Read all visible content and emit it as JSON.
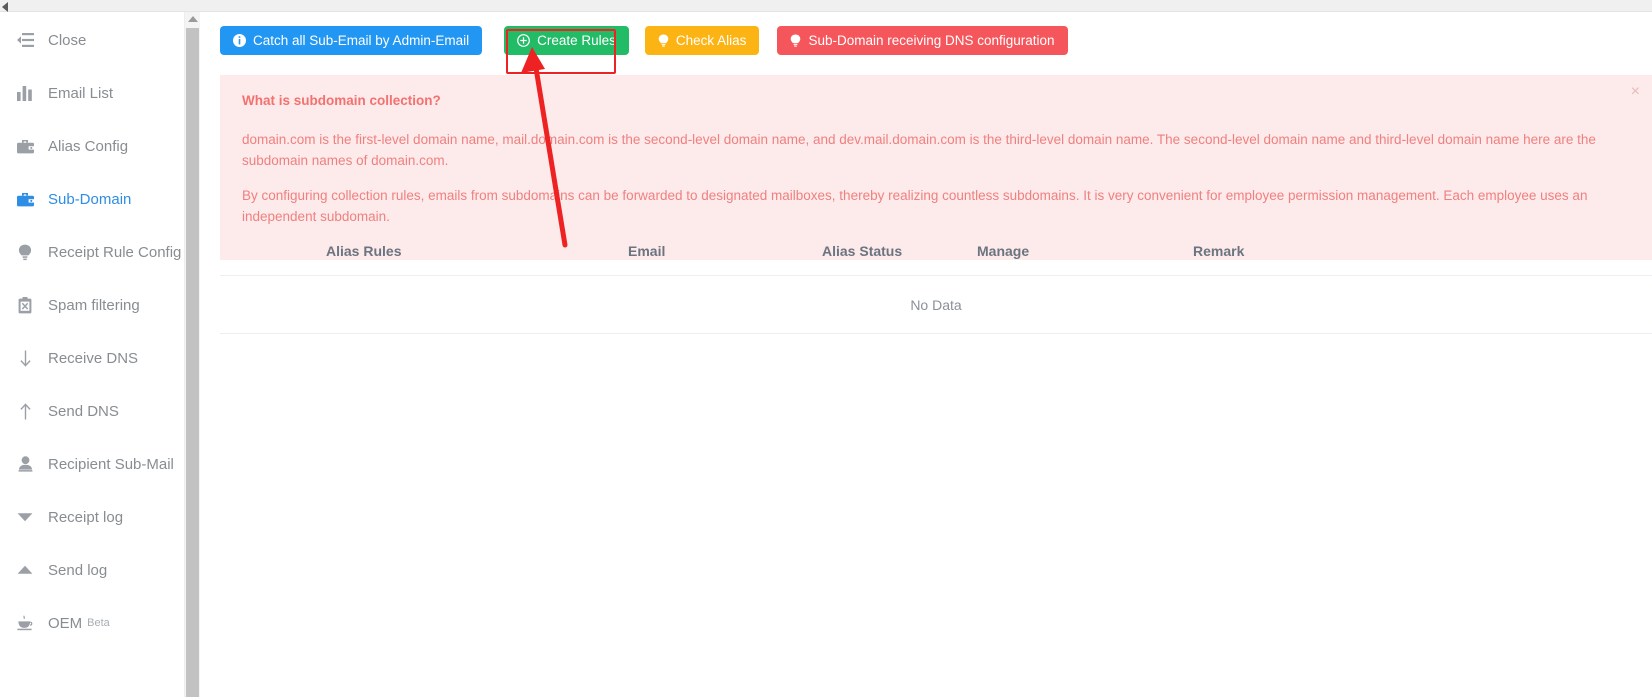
{
  "sidebar": {
    "items": [
      {
        "label": "Close",
        "icon": "menu-indent-icon",
        "active": false,
        "sub": ""
      },
      {
        "label": "Email List",
        "icon": "bar-chart-icon",
        "active": false,
        "sub": ""
      },
      {
        "label": "Alias Config",
        "icon": "briefcase-icon",
        "active": false,
        "sub": ""
      },
      {
        "label": "Sub-Domain",
        "icon": "briefcase-icon",
        "active": true,
        "sub": ""
      },
      {
        "label": "Receipt Rule Config",
        "icon": "lightbulb-icon",
        "active": false,
        "sub": ""
      },
      {
        "label": "Spam filtering",
        "icon": "clipboard-x-icon",
        "active": false,
        "sub": ""
      },
      {
        "label": "Receive DNS",
        "icon": "arrow-down-icon",
        "active": false,
        "sub": ""
      },
      {
        "label": "Send DNS",
        "icon": "arrow-up-icon",
        "active": false,
        "sub": ""
      },
      {
        "label": "Recipient Sub-Mail",
        "icon": "user-icon",
        "active": false,
        "sub": ""
      },
      {
        "label": "Receipt log",
        "icon": "triangle-down-icon",
        "active": false,
        "sub": ""
      },
      {
        "label": "Send log",
        "icon": "triangle-up-icon",
        "active": false,
        "sub": ""
      },
      {
        "label": "OEM",
        "icon": "cup-icon",
        "active": false,
        "sub": "Beta"
      }
    ]
  },
  "toolbar": {
    "buttons": [
      {
        "label": "Catch all Sub-Email by Admin-Email",
        "icon": "info-circle-icon",
        "color": "#2196f3"
      },
      {
        "label": "Create Rules",
        "icon": "plus-circle-icon",
        "color": "#22bb66"
      },
      {
        "label": "Check Alias",
        "icon": "lightbulb-icon",
        "color": "#fcb415"
      },
      {
        "label": "Sub-Domain receiving DNS configuration",
        "icon": "lightbulb-icon",
        "color": "#f5565c"
      }
    ]
  },
  "alert": {
    "title": "What is subdomain collection?",
    "paragraph1": "domain.com is the first-level domain name, mail.domain.com is the second-level domain name, and dev.mail.domain.com is the third-level domain name. The second-level domain name and third-level domain name here are the subdomain names of domain.com.",
    "paragraph2": "By configuring collection rules, emails from subdomains can be forwarded to designated mailboxes, thereby realizing countless subdomains. It is very convenient for employee permission management. Each employee uses an independent subdomain.",
    "close_label": "×"
  },
  "table": {
    "headers": [
      "Alias Rules",
      "Email",
      "Alias Status",
      "Manage",
      "Remark"
    ],
    "empty_message": "No Data"
  },
  "annotation": {
    "highlight_color": "#ee2222",
    "arrow_color": "#ee2222",
    "target": "Create Rules"
  }
}
